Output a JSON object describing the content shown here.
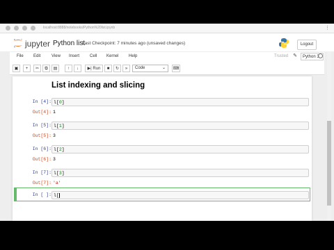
{
  "browser": {
    "url": "localhost:8888/notebooks/Python%20list.ipynb"
  },
  "header": {
    "brand": "jupyter",
    "title": "Python list",
    "checkpoint": "Last Checkpoint: 7 minutes ago",
    "unsaved": "(unsaved changes)",
    "logout_label": "Logout"
  },
  "menu": {
    "items": [
      "File",
      "Edit",
      "View",
      "Insert",
      "Cell",
      "Kernel",
      "Help"
    ],
    "trusted": "Trusted",
    "kernel": "Python 3"
  },
  "toolbar": {
    "run_label": "Run",
    "cell_type": "Code"
  },
  "notebook": {
    "heading": "List indexing and slicing",
    "cells": [
      {
        "in": "In [4]:",
        "code_var": "l",
        "code_idx": "0",
        "out": "Out[4]:",
        "result": "1",
        "is_str": false
      },
      {
        "in": "In [5]:",
        "code_var": "l",
        "code_idx": "1",
        "out": "Out[5]:",
        "result": "3",
        "is_str": false
      },
      {
        "in": "In [6]:",
        "code_var": "l",
        "code_idx": "2",
        "out": "Out[6]:",
        "result": "3",
        "is_str": false
      },
      {
        "in": "In [7]:",
        "code_var": "l",
        "code_idx": "3",
        "out": "Out[7]:",
        "result": "'a'",
        "is_str": true
      }
    ],
    "active": {
      "in": "In [ ]:",
      "code_var": "l",
      "code_bracket": "["
    }
  },
  "colors": {
    "prompt_in": "#303f9f",
    "prompt_out": "#d84315",
    "active_border": "#66bb6a"
  }
}
